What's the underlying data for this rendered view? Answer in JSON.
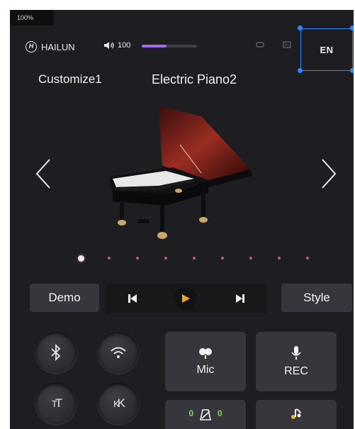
{
  "status": {
    "zoom": "100%"
  },
  "header": {
    "brand": "HAILUN",
    "volume_value": "100",
    "volume_level": 0.45,
    "lang_button": "EN",
    "icons": [
      "loop-icon",
      "box-icon"
    ]
  },
  "sound": {
    "customize": "Customize1",
    "current": "Electric Piano2",
    "page_count": 9,
    "active_page": 0
  },
  "controls": {
    "demo": "Demo",
    "style": "Style"
  },
  "cards": {
    "mic": "Mic",
    "rec": "REC",
    "count_left": "0",
    "count_right": "0"
  },
  "round_buttons": {
    "tt": "T",
    "kk": "K"
  },
  "colors": {
    "accent_purple": "#a36cf0",
    "play_orange": "#f3a51a",
    "selection_blue": "#2b88ff",
    "dot_pink": "#b05d8c"
  }
}
